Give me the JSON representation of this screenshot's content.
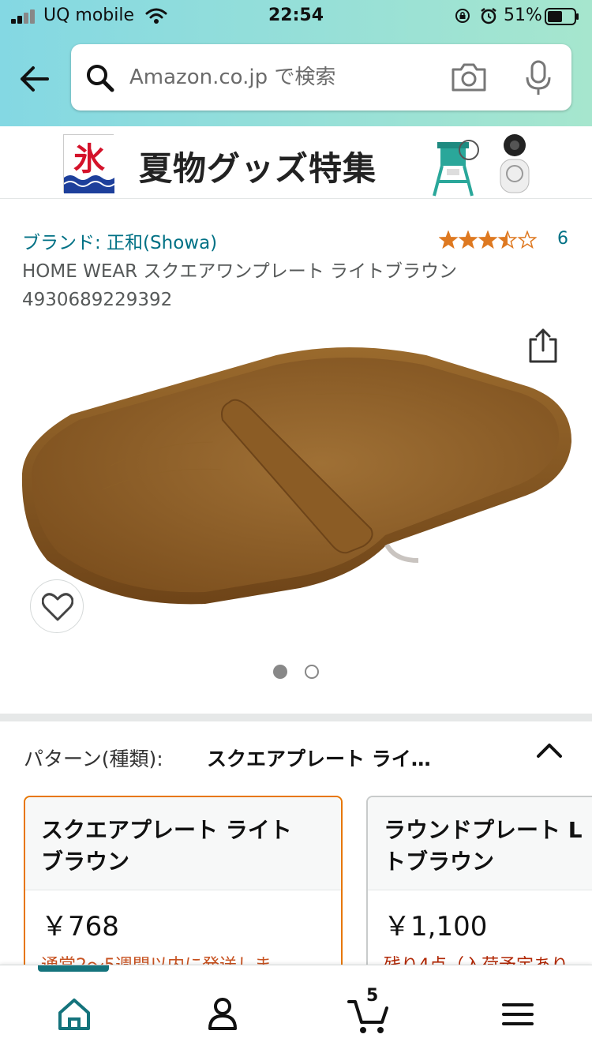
{
  "status_bar": {
    "carrier": "UQ mobile",
    "time": "22:54",
    "battery": "51%"
  },
  "search": {
    "placeholder": "Amazon.co.jp で検索"
  },
  "banner": {
    "title": "夏物グッズ特集",
    "logo_text": "氷"
  },
  "product": {
    "brand": "ブランド: 正和(Showa)",
    "rating": 3.5,
    "review_count": "6",
    "title_line1": "HOME WEAR スクエアワンプレート ライトブラウン",
    "title_line2": "4930689229392",
    "image_count": 2,
    "current_image": 1
  },
  "variations": {
    "label": "パターン(種類):",
    "selected_value": "スクエアプレート ライ…",
    "cards": [
      {
        "name": "スクエアプレート ライト\nブラウン",
        "price": "￥768",
        "note": "通常2～5週間以内に発送しま"
      },
      {
        "name": "ラウンドプレート L\nトブラウン",
        "price": "￥1,100",
        "note": "残り4点（入荷予定あり"
      }
    ]
  },
  "bottom_nav": {
    "items": [
      "home-icon",
      "account-icon",
      "cart-icon",
      "menu-icon"
    ],
    "cart_count": "5"
  },
  "colors": {
    "header_start": "#84d8e3",
    "header_end": "#a6e6ce",
    "link": "#007185",
    "selected_border": "#e77600",
    "star": "#de7921",
    "nav_active": "#14737c",
    "plate": "#8a5a22"
  }
}
